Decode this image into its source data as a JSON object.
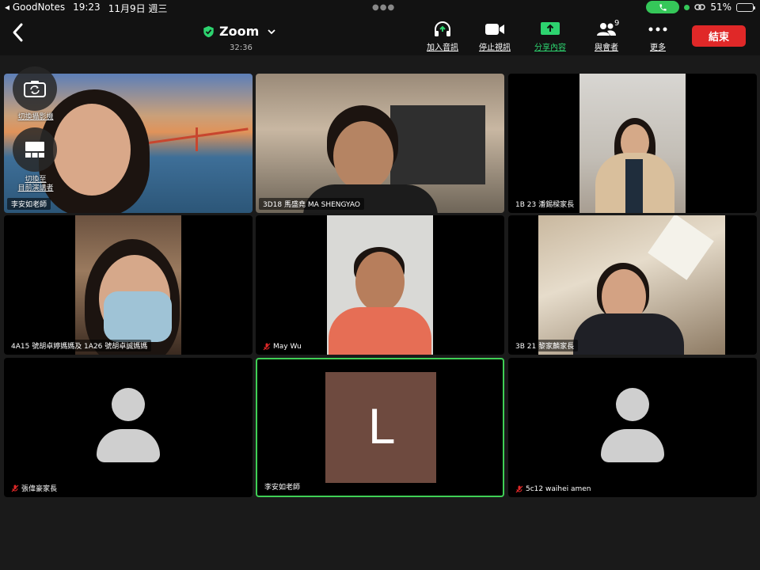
{
  "status_bar": {
    "back_app": "◂ GoodNotes",
    "time": "19:23",
    "date": "11月9日 週三",
    "battery": "51%",
    "battery_level": 0.51
  },
  "toolbar": {
    "title": "Zoom",
    "timer": "32:36",
    "items": [
      {
        "label": "加入音訊",
        "icon": "headphones-icon"
      },
      {
        "label": "停止視訊",
        "icon": "video-camera-icon"
      },
      {
        "label": "分享內容",
        "icon": "share-screen-icon"
      },
      {
        "label": "與會者",
        "icon": "participants-icon",
        "count": "9"
      },
      {
        "label": "更多",
        "icon": "more-icon"
      }
    ],
    "end_label": "結束"
  },
  "overlay": {
    "switch_camera_label": "切換攝影機",
    "switch_speaker_label": "切換至\n目前演講者"
  },
  "tiles": [
    {
      "name": "李安如老師",
      "muted": false
    },
    {
      "name": "3D18 馬盛堯 MA SHENGYAO",
      "muted": false
    },
    {
      "name": "1B 23 潘錫樑家長",
      "muted": false
    },
    {
      "name": "4A15 號胡卓婷媽媽及 1A26 號胡卓誠媽媽",
      "muted": false
    },
    {
      "name": "May Wu",
      "muted": true
    },
    {
      "name": "3B 21 黎家麟家長",
      "muted": false
    },
    {
      "name": "張偉豪家長",
      "muted": true
    },
    {
      "name": "李安如老師",
      "muted": false,
      "avatar_letter": "L"
    },
    {
      "name": "5c12 waihei  amen",
      "muted": true
    }
  ],
  "colors": {
    "end_button": "#e02828",
    "active_border": "#3fcf55",
    "share_icon": "#2dd36f",
    "avatar_box": "#6e4a3f"
  }
}
